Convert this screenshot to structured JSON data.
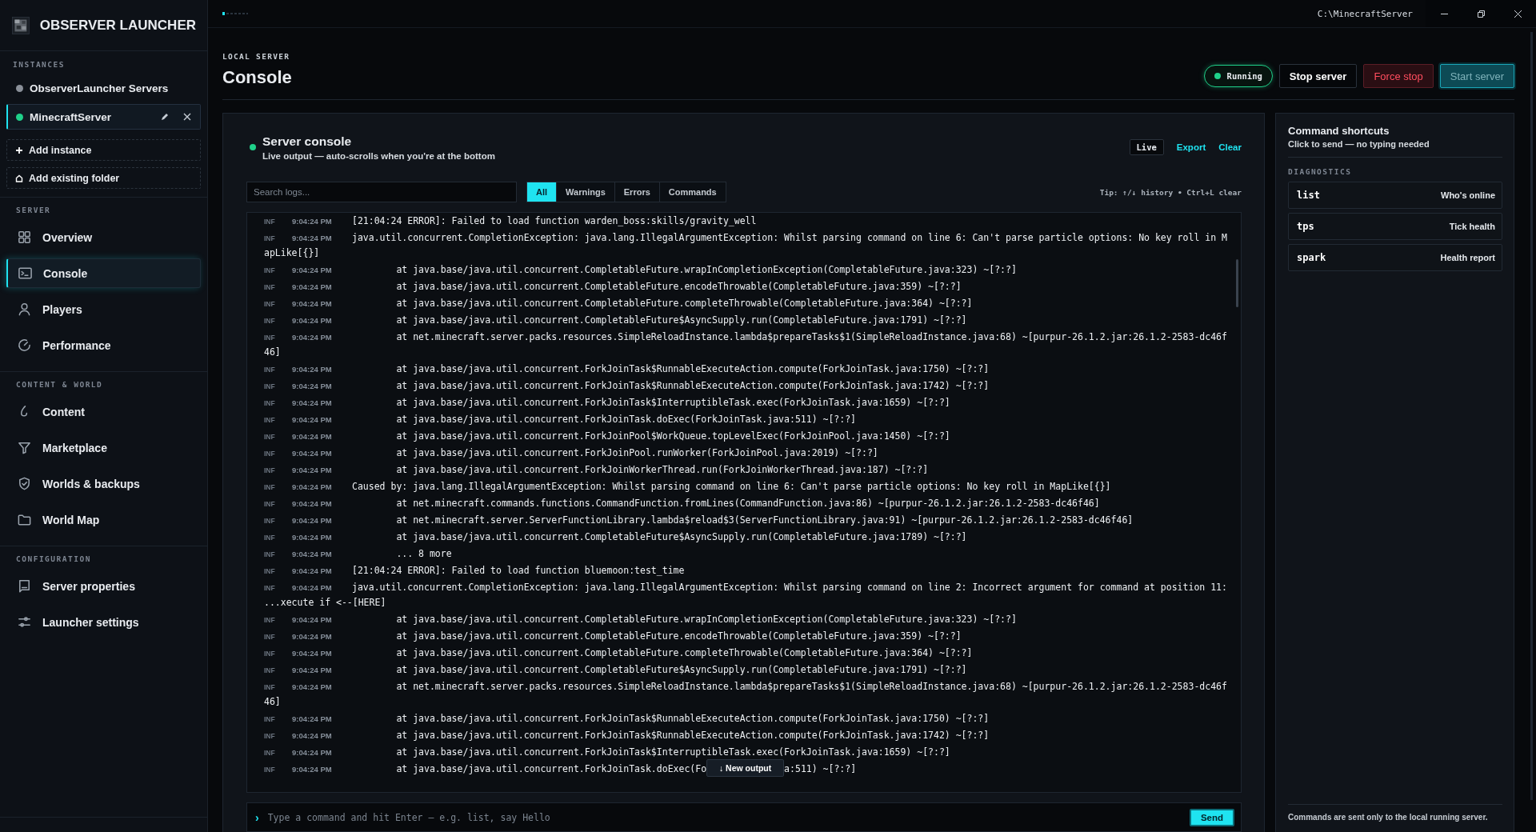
{
  "app": {
    "title": "OBSERVER LAUNCHER"
  },
  "titlebar": {
    "path": "C:\\MinecraftServer"
  },
  "sidebar": {
    "instances_heading": "INSTANCES",
    "instances": [
      {
        "name": "ObserverLauncher Servers",
        "color": "#8a9099",
        "selected": false
      },
      {
        "name": "MinecraftServer",
        "color": "#1fd18a",
        "selected": true
      }
    ],
    "add_instance": "Add instance",
    "add_folder": "Add existing folder",
    "sections": [
      {
        "heading": "SERVER",
        "items": [
          {
            "label": "Overview",
            "selected": false
          },
          {
            "label": "Console",
            "selected": true
          },
          {
            "label": "Players",
            "selected": false
          },
          {
            "label": "Performance",
            "selected": false
          }
        ]
      },
      {
        "heading": "CONTENT & WORLD",
        "items": [
          {
            "label": "Content",
            "selected": false
          },
          {
            "label": "Marketplace",
            "selected": false
          },
          {
            "label": "Worlds & backups",
            "selected": false
          },
          {
            "label": "World Map",
            "selected": false
          }
        ]
      },
      {
        "heading": "CONFIGURATION",
        "items": [
          {
            "label": "Server properties",
            "selected": false
          },
          {
            "label": "Launcher settings",
            "selected": false
          }
        ]
      }
    ]
  },
  "header": {
    "eyebrow": "LOCAL SERVER",
    "title": "Console",
    "status": "Running",
    "buttons": [
      {
        "label": "Stop server",
        "kind": "plain"
      },
      {
        "label": "Force stop",
        "kind": "danger"
      },
      {
        "label": "Start server",
        "kind": "primary"
      }
    ]
  },
  "console": {
    "title": "Server console",
    "subtitle": "Live output — auto-scrolls when you're at the bottom",
    "live": "Live",
    "export": "Export",
    "clear": "Clear",
    "search": {
      "placeholder": "Search logs..."
    },
    "filters": [
      {
        "label": "All",
        "selected": true
      },
      {
        "label": "Warnings",
        "selected": false
      },
      {
        "label": "Errors",
        "selected": false
      },
      {
        "label": "Commands",
        "selected": false
      }
    ],
    "tip": "Tip: ↑/↓ history • Ctrl+L clear",
    "logs": [
      {
        "level": "INF",
        "time": "9:04:24 PM",
        "message": "[21:04:24 ERROR]: Failed to load function warden_boss:skills/gravity_well"
      },
      {
        "level": "INF",
        "time": "9:04:24 PM",
        "message": "java.util.concurrent.CompletionException: java.lang.IllegalArgumentException: Whilst parsing command on line 6: Can't parse particle options: No key roll in M",
        "continuation": "apLike[{}]"
      },
      {
        "level": "INF",
        "time": "9:04:24 PM",
        "message": "        at java.base/java.util.concurrent.CompletableFuture.wrapInCompletionException(CompletableFuture.java:323) ~[?:?]"
      },
      {
        "level": "INF",
        "time": "9:04:24 PM",
        "message": "        at java.base/java.util.concurrent.CompletableFuture.encodeThrowable(CompletableFuture.java:359) ~[?:?]"
      },
      {
        "level": "INF",
        "time": "9:04:24 PM",
        "message": "        at java.base/java.util.concurrent.CompletableFuture.completeThrowable(CompletableFuture.java:364) ~[?:?]"
      },
      {
        "level": "INF",
        "time": "9:04:24 PM",
        "message": "        at java.base/java.util.concurrent.CompletableFuture$AsyncSupply.run(CompletableFuture.java:1791) ~[?:?]"
      },
      {
        "level": "INF",
        "time": "9:04:24 PM",
        "message": "        at net.minecraft.server.packs.resources.SimpleReloadInstance.lambda$prepareTasks$1(SimpleReloadInstance.java:68) ~[purpur-26.1.2.jar:26.1.2-2583-dc46f",
        "continuation": "46]"
      },
      {
        "level": "INF",
        "time": "9:04:24 PM",
        "message": "        at java.base/java.util.concurrent.ForkJoinTask$RunnableExecuteAction.compute(ForkJoinTask.java:1750) ~[?:?]"
      },
      {
        "level": "INF",
        "time": "9:04:24 PM",
        "message": "        at java.base/java.util.concurrent.ForkJoinTask$RunnableExecuteAction.compute(ForkJoinTask.java:1742) ~[?:?]"
      },
      {
        "level": "INF",
        "time": "9:04:24 PM",
        "message": "        at java.base/java.util.concurrent.ForkJoinTask$InterruptibleTask.exec(ForkJoinTask.java:1659) ~[?:?]"
      },
      {
        "level": "INF",
        "time": "9:04:24 PM",
        "message": "        at java.base/java.util.concurrent.ForkJoinTask.doExec(ForkJoinTask.java:511) ~[?:?]"
      },
      {
        "level": "INF",
        "time": "9:04:24 PM",
        "message": "        at java.base/java.util.concurrent.ForkJoinPool$WorkQueue.topLevelExec(ForkJoinPool.java:1450) ~[?:?]"
      },
      {
        "level": "INF",
        "time": "9:04:24 PM",
        "message": "        at java.base/java.util.concurrent.ForkJoinPool.runWorker(ForkJoinPool.java:2019) ~[?:?]"
      },
      {
        "level": "INF",
        "time": "9:04:24 PM",
        "message": "        at java.base/java.util.concurrent.ForkJoinWorkerThread.run(ForkJoinWorkerThread.java:187) ~[?:?]"
      },
      {
        "level": "INF",
        "time": "9:04:24 PM",
        "message": "Caused by: java.lang.IllegalArgumentException: Whilst parsing command on line 6: Can't parse particle options: No key roll in MapLike[{}]"
      },
      {
        "level": "INF",
        "time": "9:04:24 PM",
        "message": "        at net.minecraft.commands.functions.CommandFunction.fromLines(CommandFunction.java:86) ~[purpur-26.1.2.jar:26.1.2-2583-dc46f46]"
      },
      {
        "level": "INF",
        "time": "9:04:24 PM",
        "message": "        at net.minecraft.server.ServerFunctionLibrary.lambda$reload$3(ServerFunctionLibrary.java:91) ~[purpur-26.1.2.jar:26.1.2-2583-dc46f46]"
      },
      {
        "level": "INF",
        "time": "9:04:24 PM",
        "message": "        at java.base/java.util.concurrent.CompletableFuture$AsyncSupply.run(CompletableFuture.java:1789) ~[?:?]"
      },
      {
        "level": "INF",
        "time": "9:04:24 PM",
        "message": "        ... 8 more"
      },
      {
        "level": "INF",
        "time": "9:04:24 PM",
        "message": "[21:04:24 ERROR]: Failed to load function bluemoon:test_time"
      },
      {
        "level": "INF",
        "time": "9:04:24 PM",
        "message": "java.util.concurrent.CompletionException: java.lang.IllegalArgumentException: Whilst parsing command on line 2: Incorrect argument for command at position 11:",
        "continuation": "...xecute if <--[HERE]"
      },
      {
        "level": "INF",
        "time": "9:04:24 PM",
        "message": "        at java.base/java.util.concurrent.CompletableFuture.wrapInCompletionException(CompletableFuture.java:323) ~[?:?]"
      },
      {
        "level": "INF",
        "time": "9:04:24 PM",
        "message": "        at java.base/java.util.concurrent.CompletableFuture.encodeThrowable(CompletableFuture.java:359) ~[?:?]"
      },
      {
        "level": "INF",
        "time": "9:04:24 PM",
        "message": "        at java.base/java.util.concurrent.CompletableFuture.completeThrowable(CompletableFuture.java:364) ~[?:?]"
      },
      {
        "level": "INF",
        "time": "9:04:24 PM",
        "message": "        at java.base/java.util.concurrent.CompletableFuture$AsyncSupply.run(CompletableFuture.java:1791) ~[?:?]"
      },
      {
        "level": "INF",
        "time": "9:04:24 PM",
        "message": "        at net.minecraft.server.packs.resources.SimpleReloadInstance.lambda$prepareTasks$1(SimpleReloadInstance.java:68) ~[purpur-26.1.2.jar:26.1.2-2583-dc46f",
        "continuation": "46]"
      },
      {
        "level": "INF",
        "time": "9:04:24 PM",
        "message": "        at java.base/java.util.concurrent.ForkJoinTask$RunnableExecuteAction.compute(ForkJoinTask.java:1750) ~[?:?]"
      },
      {
        "level": "INF",
        "time": "9:04:24 PM",
        "message": "        at java.base/java.util.concurrent.ForkJoinTask$RunnableExecuteAction.compute(ForkJoinTask.java:1742) ~[?:?]"
      },
      {
        "level": "INF",
        "time": "9:04:24 PM",
        "message": "        at java.base/java.util.concurrent.ForkJoinTask$InterruptibleTask.exec(ForkJoinTask.java:1659) ~[?:?]"
      },
      {
        "level": "INF",
        "time": "9:04:24 PM",
        "message": "        at java.base/java.util.concurrent.ForkJoinTask.doExec(Fo",
        "message_after": "a:511) ~[?:?]"
      }
    ],
    "new_output": "↓ New output",
    "command": {
      "prompt": "›",
      "placeholder": "Type a command and hit Enter — e.g. list, say Hello"
    },
    "send": "Send"
  },
  "shortcuts": {
    "title": "Command shortcuts",
    "subtitle": "Click to send — no typing needed",
    "group": "DIAGNOSTICS",
    "items": [
      {
        "command": "list",
        "description": "Who's online"
      },
      {
        "command": "tps",
        "description": "Tick health"
      },
      {
        "command": "spark",
        "description": "Health report"
      }
    ],
    "footer": "Commands are sent only to the local running server."
  }
}
